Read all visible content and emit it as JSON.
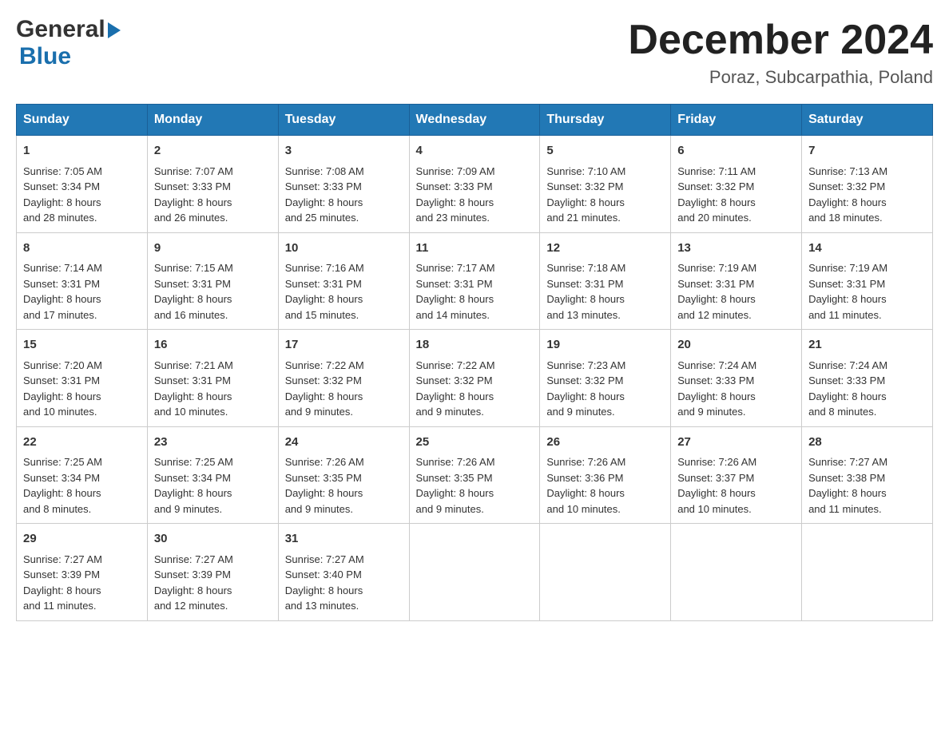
{
  "header": {
    "logo_general": "General",
    "logo_blue": "Blue",
    "month_title": "December 2024",
    "location": "Poraz, Subcarpathia, Poland"
  },
  "days_of_week": [
    "Sunday",
    "Monday",
    "Tuesday",
    "Wednesday",
    "Thursday",
    "Friday",
    "Saturday"
  ],
  "weeks": [
    [
      {
        "day": "1",
        "sunrise": "Sunrise: 7:05 AM",
        "sunset": "Sunset: 3:34 PM",
        "daylight": "Daylight: 8 hours",
        "daylight2": "and 28 minutes."
      },
      {
        "day": "2",
        "sunrise": "Sunrise: 7:07 AM",
        "sunset": "Sunset: 3:33 PM",
        "daylight": "Daylight: 8 hours",
        "daylight2": "and 26 minutes."
      },
      {
        "day": "3",
        "sunrise": "Sunrise: 7:08 AM",
        "sunset": "Sunset: 3:33 PM",
        "daylight": "Daylight: 8 hours",
        "daylight2": "and 25 minutes."
      },
      {
        "day": "4",
        "sunrise": "Sunrise: 7:09 AM",
        "sunset": "Sunset: 3:33 PM",
        "daylight": "Daylight: 8 hours",
        "daylight2": "and 23 minutes."
      },
      {
        "day": "5",
        "sunrise": "Sunrise: 7:10 AM",
        "sunset": "Sunset: 3:32 PM",
        "daylight": "Daylight: 8 hours",
        "daylight2": "and 21 minutes."
      },
      {
        "day": "6",
        "sunrise": "Sunrise: 7:11 AM",
        "sunset": "Sunset: 3:32 PM",
        "daylight": "Daylight: 8 hours",
        "daylight2": "and 20 minutes."
      },
      {
        "day": "7",
        "sunrise": "Sunrise: 7:13 AM",
        "sunset": "Sunset: 3:32 PM",
        "daylight": "Daylight: 8 hours",
        "daylight2": "and 18 minutes."
      }
    ],
    [
      {
        "day": "8",
        "sunrise": "Sunrise: 7:14 AM",
        "sunset": "Sunset: 3:31 PM",
        "daylight": "Daylight: 8 hours",
        "daylight2": "and 17 minutes."
      },
      {
        "day": "9",
        "sunrise": "Sunrise: 7:15 AM",
        "sunset": "Sunset: 3:31 PM",
        "daylight": "Daylight: 8 hours",
        "daylight2": "and 16 minutes."
      },
      {
        "day": "10",
        "sunrise": "Sunrise: 7:16 AM",
        "sunset": "Sunset: 3:31 PM",
        "daylight": "Daylight: 8 hours",
        "daylight2": "and 15 minutes."
      },
      {
        "day": "11",
        "sunrise": "Sunrise: 7:17 AM",
        "sunset": "Sunset: 3:31 PM",
        "daylight": "Daylight: 8 hours",
        "daylight2": "and 14 minutes."
      },
      {
        "day": "12",
        "sunrise": "Sunrise: 7:18 AM",
        "sunset": "Sunset: 3:31 PM",
        "daylight": "Daylight: 8 hours",
        "daylight2": "and 13 minutes."
      },
      {
        "day": "13",
        "sunrise": "Sunrise: 7:19 AM",
        "sunset": "Sunset: 3:31 PM",
        "daylight": "Daylight: 8 hours",
        "daylight2": "and 12 minutes."
      },
      {
        "day": "14",
        "sunrise": "Sunrise: 7:19 AM",
        "sunset": "Sunset: 3:31 PM",
        "daylight": "Daylight: 8 hours",
        "daylight2": "and 11 minutes."
      }
    ],
    [
      {
        "day": "15",
        "sunrise": "Sunrise: 7:20 AM",
        "sunset": "Sunset: 3:31 PM",
        "daylight": "Daylight: 8 hours",
        "daylight2": "and 10 minutes."
      },
      {
        "day": "16",
        "sunrise": "Sunrise: 7:21 AM",
        "sunset": "Sunset: 3:31 PM",
        "daylight": "Daylight: 8 hours",
        "daylight2": "and 10 minutes."
      },
      {
        "day": "17",
        "sunrise": "Sunrise: 7:22 AM",
        "sunset": "Sunset: 3:32 PM",
        "daylight": "Daylight: 8 hours",
        "daylight2": "and 9 minutes."
      },
      {
        "day": "18",
        "sunrise": "Sunrise: 7:22 AM",
        "sunset": "Sunset: 3:32 PM",
        "daylight": "Daylight: 8 hours",
        "daylight2": "and 9 minutes."
      },
      {
        "day": "19",
        "sunrise": "Sunrise: 7:23 AM",
        "sunset": "Sunset: 3:32 PM",
        "daylight": "Daylight: 8 hours",
        "daylight2": "and 9 minutes."
      },
      {
        "day": "20",
        "sunrise": "Sunrise: 7:24 AM",
        "sunset": "Sunset: 3:33 PM",
        "daylight": "Daylight: 8 hours",
        "daylight2": "and 9 minutes."
      },
      {
        "day": "21",
        "sunrise": "Sunrise: 7:24 AM",
        "sunset": "Sunset: 3:33 PM",
        "daylight": "Daylight: 8 hours",
        "daylight2": "and 8 minutes."
      }
    ],
    [
      {
        "day": "22",
        "sunrise": "Sunrise: 7:25 AM",
        "sunset": "Sunset: 3:34 PM",
        "daylight": "Daylight: 8 hours",
        "daylight2": "and 8 minutes."
      },
      {
        "day": "23",
        "sunrise": "Sunrise: 7:25 AM",
        "sunset": "Sunset: 3:34 PM",
        "daylight": "Daylight: 8 hours",
        "daylight2": "and 9 minutes."
      },
      {
        "day": "24",
        "sunrise": "Sunrise: 7:26 AM",
        "sunset": "Sunset: 3:35 PM",
        "daylight": "Daylight: 8 hours",
        "daylight2": "and 9 minutes."
      },
      {
        "day": "25",
        "sunrise": "Sunrise: 7:26 AM",
        "sunset": "Sunset: 3:35 PM",
        "daylight": "Daylight: 8 hours",
        "daylight2": "and 9 minutes."
      },
      {
        "day": "26",
        "sunrise": "Sunrise: 7:26 AM",
        "sunset": "Sunset: 3:36 PM",
        "daylight": "Daylight: 8 hours",
        "daylight2": "and 10 minutes."
      },
      {
        "day": "27",
        "sunrise": "Sunrise: 7:26 AM",
        "sunset": "Sunset: 3:37 PM",
        "daylight": "Daylight: 8 hours",
        "daylight2": "and 10 minutes."
      },
      {
        "day": "28",
        "sunrise": "Sunrise: 7:27 AM",
        "sunset": "Sunset: 3:38 PM",
        "daylight": "Daylight: 8 hours",
        "daylight2": "and 11 minutes."
      }
    ],
    [
      {
        "day": "29",
        "sunrise": "Sunrise: 7:27 AM",
        "sunset": "Sunset: 3:39 PM",
        "daylight": "Daylight: 8 hours",
        "daylight2": "and 11 minutes."
      },
      {
        "day": "30",
        "sunrise": "Sunrise: 7:27 AM",
        "sunset": "Sunset: 3:39 PM",
        "daylight": "Daylight: 8 hours",
        "daylight2": "and 12 minutes."
      },
      {
        "day": "31",
        "sunrise": "Sunrise: 7:27 AM",
        "sunset": "Sunset: 3:40 PM",
        "daylight": "Daylight: 8 hours",
        "daylight2": "and 13 minutes."
      },
      null,
      null,
      null,
      null
    ]
  ]
}
